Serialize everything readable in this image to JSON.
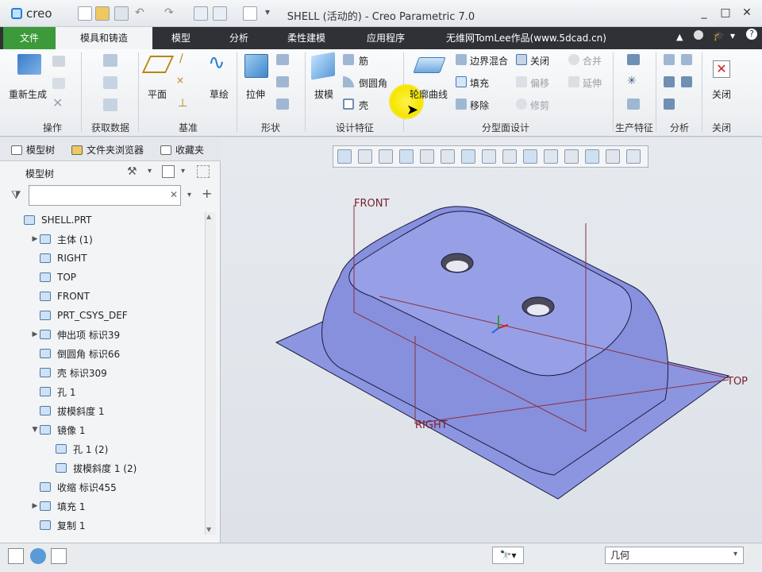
{
  "app": {
    "logo": "creo",
    "title": "SHELL (活动的) - Creo Parametric 7.0",
    "window_controls": [
      "minimize-icon",
      "maximize-icon",
      "close-icon"
    ]
  },
  "tabs": {
    "file": "文件",
    "mold": "模具和铸造",
    "model": "模型",
    "analysis": "分析",
    "flex": "柔性建模",
    "apps": "应用程序",
    "watermark": "无维网TomLee作品(www.5dcad.cn)"
  },
  "ribbon": {
    "regenerate": "重新生成",
    "plane": "平面",
    "sketch": "草绘",
    "extrude": "拉伸",
    "draft": "拔模",
    "rib": "筋",
    "round": "倒圆角",
    "shell": "壳",
    "silhouette": "轮廓曲线",
    "boundary_blend": "边界混合",
    "close": "关闭",
    "merge": "合并",
    "fill": "填充",
    "offset": "偏移",
    "extend": "延伸",
    "move": "移除",
    "trim": "修剪",
    "close_button": "关闭",
    "groups": {
      "operations": "操作",
      "get_data": "获取数据",
      "datum": "基准",
      "shapes": "形状",
      "design_features": "设计特征",
      "parting_surface": "分型面设计",
      "production": "生产特征",
      "analysis": "分析",
      "close": "关闭"
    }
  },
  "left_panel": {
    "tabs": [
      "模型树",
      "文件夹浏览器",
      "收藏夹"
    ],
    "header": "模型树",
    "search_placeholder": "",
    "tree": [
      {
        "label": "SHELL.PRT",
        "indent": 0,
        "expand": ""
      },
      {
        "label": "主体 (1)",
        "indent": 1,
        "expand": "▶"
      },
      {
        "label": "RIGHT",
        "indent": 1,
        "expand": ""
      },
      {
        "label": "TOP",
        "indent": 1,
        "expand": ""
      },
      {
        "label": "FRONT",
        "indent": 1,
        "expand": ""
      },
      {
        "label": "PRT_CSYS_DEF",
        "indent": 1,
        "expand": ""
      },
      {
        "label": "伸出项 标识39",
        "indent": 1,
        "expand": "▶"
      },
      {
        "label": "倒圆角 标识66",
        "indent": 1,
        "expand": ""
      },
      {
        "label": "壳 标识309",
        "indent": 1,
        "expand": ""
      },
      {
        "label": "孔 1",
        "indent": 1,
        "expand": ""
      },
      {
        "label": "拔模斜度 1",
        "indent": 1,
        "expand": ""
      },
      {
        "label": "镜像 1",
        "indent": 1,
        "expand": "▼"
      },
      {
        "label": "孔 1 (2)",
        "indent": 2,
        "expand": ""
      },
      {
        "label": "拔模斜度 1 (2)",
        "indent": 2,
        "expand": ""
      },
      {
        "label": "收缩 标识455",
        "indent": 1,
        "expand": ""
      },
      {
        "label": "填充 1",
        "indent": 1,
        "expand": "▶"
      },
      {
        "label": "复制 1",
        "indent": 1,
        "expand": ""
      }
    ]
  },
  "viewport": {
    "labels": {
      "front": "FRONT",
      "top": "TOP",
      "right": "RIGHT"
    },
    "model_color": "#8c96e0"
  },
  "status": {
    "filter": "几何"
  }
}
